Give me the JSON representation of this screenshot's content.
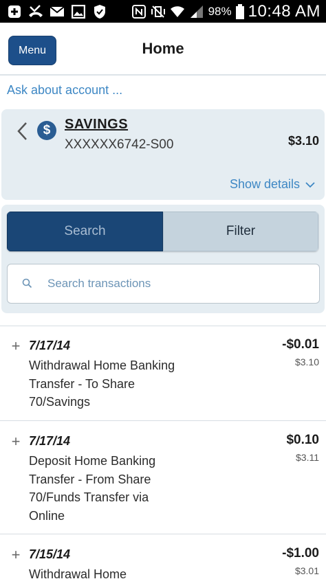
{
  "status_bar": {
    "battery": "98%",
    "time": "10:48 AM",
    "left_icons": [
      "plus-box-icon",
      "missed-call-icon",
      "mail-icon",
      "image-icon",
      "shield-icon"
    ],
    "right_icons": [
      "nfc-icon",
      "vibrate-mute-icon",
      "wifi-icon",
      "signal-icon",
      "battery-icon"
    ]
  },
  "header": {
    "menu_label": "Menu",
    "title": "Home"
  },
  "ask_link": "Ask about account ...",
  "account": {
    "name": "SAVINGS",
    "number": "XXXXXX6742-S00",
    "balance": "$3.10",
    "show_details": "Show details",
    "icon": "dollar-circle-icon"
  },
  "search": {
    "search_label": "Search",
    "filter_label": "Filter",
    "placeholder": "Search transactions"
  },
  "transactions": [
    {
      "date": "7/17/14",
      "description": "Withdrawal Home Banking Transfer - To Share 70/Savings",
      "amount": "-$0.01",
      "balance": "$3.10"
    },
    {
      "date": "7/17/14",
      "description": "Deposit Home Banking Transfer - From Share 70/Funds Transfer via Online",
      "amount": "$0.10",
      "balance": "$3.11"
    },
    {
      "date": "7/15/14",
      "description": "Withdrawal Home",
      "amount": "-$1.00",
      "balance": "$3.01"
    }
  ],
  "colors": {
    "primary": "#1d4f8a",
    "link": "#3d87c4",
    "panel": "#e5edf2"
  }
}
